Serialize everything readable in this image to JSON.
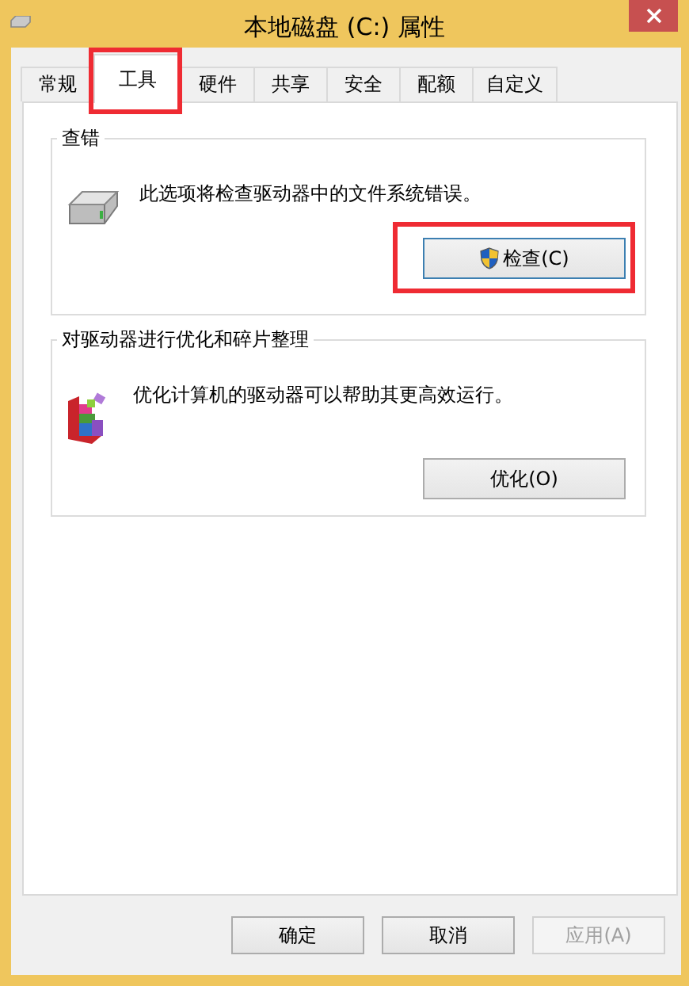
{
  "window": {
    "title": "本地磁盘 (C:) 属性"
  },
  "tabs": [
    {
      "label": "常规",
      "selected": false,
      "highlighted": false
    },
    {
      "label": "工具",
      "selected": true,
      "highlighted": true
    },
    {
      "label": "硬件",
      "selected": false,
      "highlighted": false
    },
    {
      "label": "共享",
      "selected": false,
      "highlighted": false
    },
    {
      "label": "安全",
      "selected": false,
      "highlighted": false
    },
    {
      "label": "配额",
      "selected": false,
      "highlighted": false
    },
    {
      "label": "自定义",
      "selected": false,
      "highlighted": false
    }
  ],
  "groups": [
    {
      "title": "查错",
      "kind": "check",
      "description": "此选项将检查驱动器中的文件系统错误。",
      "button": {
        "label": "检查(C)",
        "shield": true,
        "highlighted": true
      }
    },
    {
      "title": "对驱动器进行优化和碎片整理",
      "kind": "optimize",
      "description": "优化计算机的驱动器可以帮助其更高效运行。",
      "button": {
        "label": "优化(O)",
        "shield": false,
        "highlighted": false
      }
    }
  ],
  "buttons": [
    {
      "label": "确定",
      "disabled": false
    },
    {
      "label": "取消",
      "disabled": false
    },
    {
      "label": "应用(A)",
      "disabled": true
    }
  ]
}
